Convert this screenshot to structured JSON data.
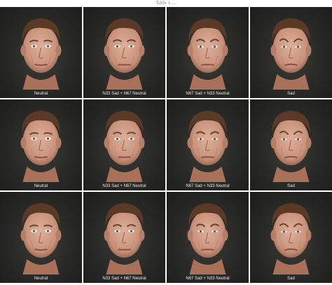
{
  "figure": {
    "caption": "Table 1. ...",
    "rows": [
      {
        "panels": [
          {
            "label": "Neutral"
          },
          {
            "label": "N33 Sad + N67 Neutral"
          },
          {
            "label": "N67 Sad + N33 Neutral"
          },
          {
            "label": "Sad"
          }
        ]
      },
      {
        "panels": [
          {
            "label": "Neutral"
          },
          {
            "label": "N33 Sad + N67 Neutral"
          },
          {
            "label": "N67 Sad + N33 Neutral"
          },
          {
            "label": "Sad"
          }
        ]
      },
      {
        "panels": [
          {
            "label": "Neutral"
          },
          {
            "label": "N33 Sad + N67 Neutral"
          },
          {
            "label": "N67 Sad + N33 Neutral"
          },
          {
            "label": "Sad"
          }
        ]
      }
    ]
  },
  "colors": {
    "background": "#262724",
    "skin": "#c9927a",
    "hair": "#5a3a26",
    "label_text": "#e8e8e8"
  }
}
